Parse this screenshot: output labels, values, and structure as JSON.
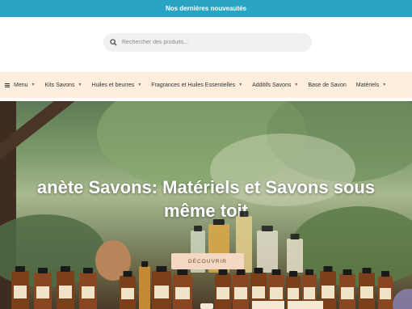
{
  "announcement": {
    "text": "Nos dernières nouveautés"
  },
  "search": {
    "placeholder": "Rechercher des produits..."
  },
  "nav": {
    "menu_label": "Menu",
    "items": [
      {
        "label": "Kits Savons"
      },
      {
        "label": "Huiles et beurres"
      },
      {
        "label": "Fragrances et Huiles Essentielles"
      },
      {
        "label": "Additifs Savons"
      },
      {
        "label": "Base de Savon"
      },
      {
        "label": "Matériels"
      }
    ]
  },
  "hero": {
    "title_line1": "anète Savons: Matériels et Savons sous",
    "title_line2": "même toit",
    "cta_label": "DÉCOUVRIR"
  },
  "colors": {
    "topbar": "#2aa3c4",
    "nav_bg": "#fdeedd",
    "cta_bg": "#f4d8c4"
  }
}
